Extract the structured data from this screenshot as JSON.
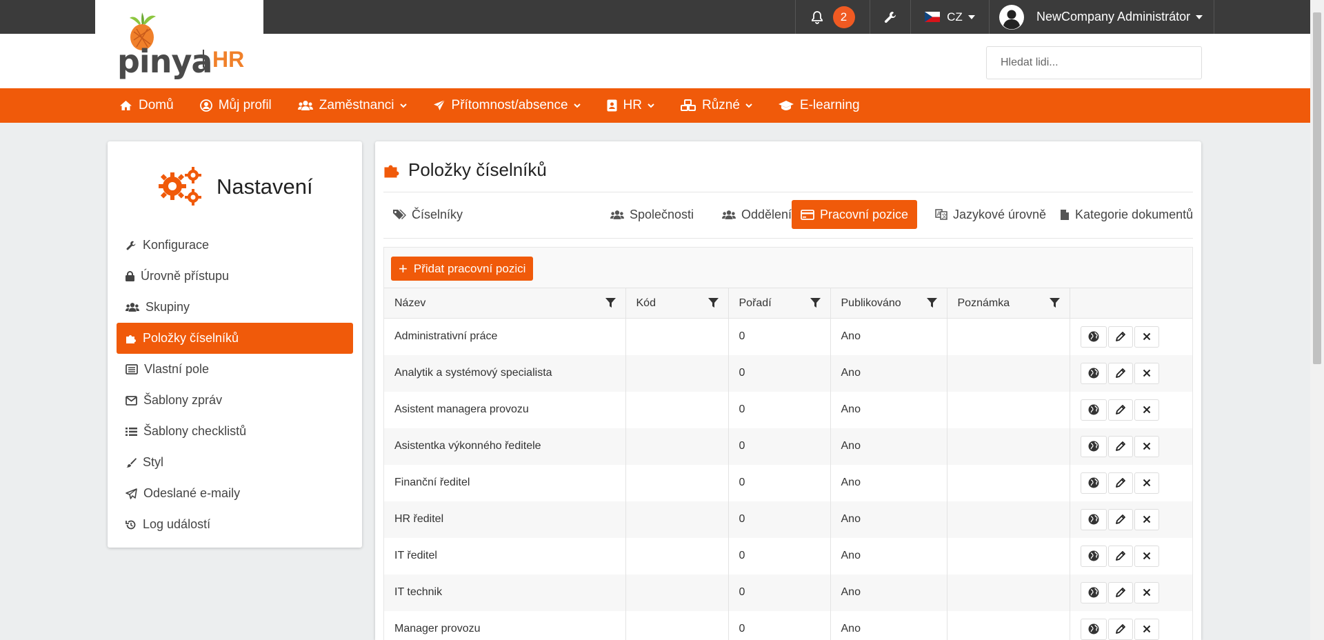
{
  "topbar": {
    "notifications_count": "2",
    "language": "CZ",
    "user_name": "NewCompany Administrátor"
  },
  "header": {
    "logo_text": "pinya",
    "logo_hr": "HR",
    "search_placeholder": "Hledat lidi..."
  },
  "nav": {
    "items": [
      {
        "label": "Domů"
      },
      {
        "label": "Můj profil"
      },
      {
        "label": "Zaměstnanci"
      },
      {
        "label": "Přítomnost/absence"
      },
      {
        "label": "HR"
      },
      {
        "label": "Různé"
      },
      {
        "label": "E-learning"
      }
    ]
  },
  "sidebar": {
    "title": "Nastavení",
    "items": [
      {
        "label": "Konfigurace"
      },
      {
        "label": "Úrovně přístupu"
      },
      {
        "label": "Skupiny"
      },
      {
        "label": "Položky číselníků"
      },
      {
        "label": "Vlastní pole"
      },
      {
        "label": "Šablony zpráv"
      },
      {
        "label": "Šablony checklistů"
      },
      {
        "label": "Styl"
      },
      {
        "label": "Odeslané e-maily"
      },
      {
        "label": "Log událostí"
      }
    ]
  },
  "main": {
    "title": "Položky číselníků",
    "tabs": [
      {
        "label": "Číselníky"
      },
      {
        "label": "Společnosti"
      },
      {
        "label": "Oddělení"
      },
      {
        "label": "Pracovní pozice"
      },
      {
        "label": "Jazykové úrovně"
      },
      {
        "label": "Kategorie dokumentů"
      }
    ],
    "add_button": "Přidat pracovní pozici",
    "columns": [
      "Název",
      "Kód",
      "Pořadí",
      "Publikováno",
      "Poznámka"
    ],
    "rows": [
      {
        "name": "Administrativní práce",
        "code": "",
        "order": "0",
        "published": "Ano",
        "note": ""
      },
      {
        "name": "Analytik a systémový specialista",
        "code": "",
        "order": "0",
        "published": "Ano",
        "note": ""
      },
      {
        "name": "Asistent managera provozu",
        "code": "",
        "order": "0",
        "published": "Ano",
        "note": ""
      },
      {
        "name": "Asistentka výkonného ředitele",
        "code": "",
        "order": "0",
        "published": "Ano",
        "note": ""
      },
      {
        "name": "Finanční ředitel",
        "code": "",
        "order": "0",
        "published": "Ano",
        "note": ""
      },
      {
        "name": "HR ředitel",
        "code": "",
        "order": "0",
        "published": "Ano",
        "note": ""
      },
      {
        "name": "IT ředitel",
        "code": "",
        "order": "0",
        "published": "Ano",
        "note": ""
      },
      {
        "name": "IT technik",
        "code": "",
        "order": "0",
        "published": "Ano",
        "note": ""
      },
      {
        "name": "Manager provozu",
        "code": "",
        "order": "0",
        "published": "Ano",
        "note": ""
      }
    ]
  },
  "colors": {
    "accent": "#f05a0a",
    "topbar": "#3b3b3b",
    "background": "#eceeef"
  }
}
